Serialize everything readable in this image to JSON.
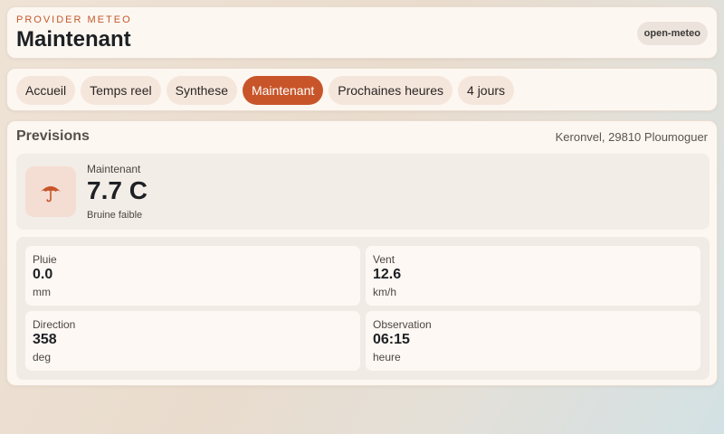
{
  "header": {
    "provider_label": "PROVIDER METEO",
    "title": "Maintenant",
    "provider_badge": "open-meteo"
  },
  "tabs": [
    {
      "label": "Accueil",
      "active": false
    },
    {
      "label": "Temps reel",
      "active": false
    },
    {
      "label": "Synthese",
      "active": false
    },
    {
      "label": "Maintenant",
      "active": true
    },
    {
      "label": "Prochaines heures",
      "active": false
    },
    {
      "label": "4 jours",
      "active": false
    }
  ],
  "main": {
    "title": "Previsions",
    "location": "Keronvel, 29810 Ploumoguer",
    "now": {
      "icon": "umbrella-icon",
      "label": "Maintenant",
      "temperature": "7.7 C",
      "description": "Bruine faible"
    },
    "metrics": [
      {
        "label": "Pluie",
        "value": "0.0",
        "unit": "mm"
      },
      {
        "label": "Vent",
        "value": "12.6",
        "unit": "km/h"
      },
      {
        "label": "Direction",
        "value": "358",
        "unit": "deg"
      },
      {
        "label": "Observation",
        "value": "06:15",
        "unit": "heure"
      }
    ]
  },
  "colors": {
    "accent": "#c8552a",
    "tab_bg": "#f5e6dc",
    "card_bg": "#fdf7f1",
    "title": "#1d2024"
  }
}
